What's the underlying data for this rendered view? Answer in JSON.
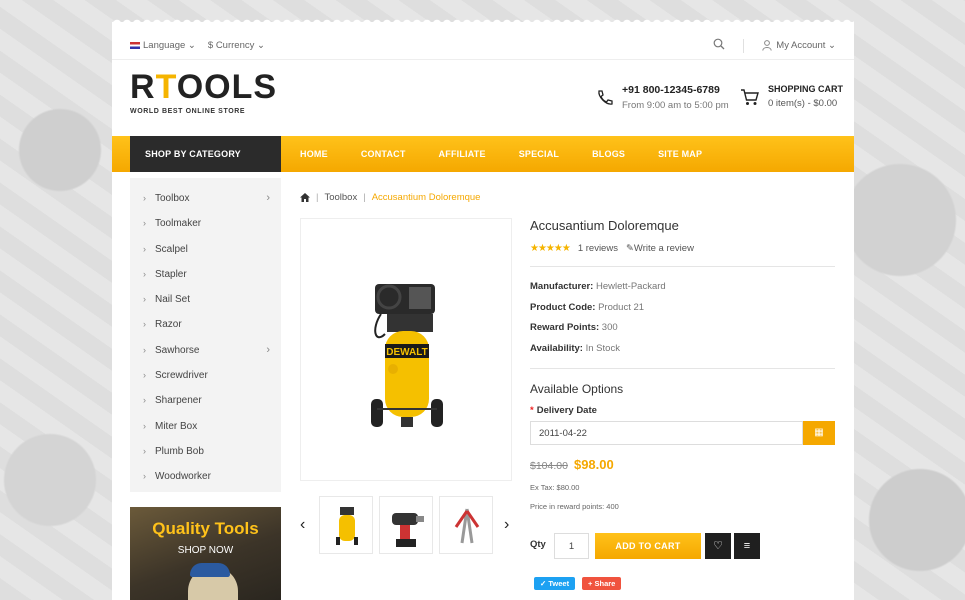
{
  "topbar": {
    "language": "Language",
    "currency": "$ Currency",
    "account": "My Account"
  },
  "logo": {
    "main_a": "R",
    "main_b": "T",
    "main_c": "OOLS",
    "tagline": "WORLD BEST ONLINE STORE"
  },
  "contact": {
    "phone": "+91 800-12345-6789",
    "hours": "From 9:00 am to 5:00 pm"
  },
  "cart": {
    "title": "SHOPPING CART",
    "summary": "0 item(s) - $0.00"
  },
  "nav": {
    "shop_by_category": "SHOP BY CATEGORY",
    "links": [
      "HOME",
      "CONTACT",
      "AFFILIATE",
      "SPECIAL",
      "BLOGS",
      "SITE MAP"
    ]
  },
  "sidebar": {
    "items": [
      {
        "label": "Toolbox",
        "has_sub": true
      },
      {
        "label": "Toolmaker",
        "has_sub": false
      },
      {
        "label": "Scalpel",
        "has_sub": false
      },
      {
        "label": "Stapler",
        "has_sub": false
      },
      {
        "label": "Nail Set",
        "has_sub": false
      },
      {
        "label": "Razor",
        "has_sub": false
      },
      {
        "label": "Sawhorse",
        "has_sub": true
      },
      {
        "label": "Screwdriver",
        "has_sub": false
      },
      {
        "label": "Sharpener",
        "has_sub": false
      },
      {
        "label": "Miter Box",
        "has_sub": false
      },
      {
        "label": "Plumb Bob",
        "has_sub": false
      },
      {
        "label": "Woodworker",
        "has_sub": false
      }
    ]
  },
  "banner": {
    "title": "Quality Tools",
    "cta": "SHOP NOW"
  },
  "breadcrumb": {
    "category": "Toolbox",
    "current": "Accusantium Doloremque"
  },
  "product": {
    "brand_on_image": "DEWALT",
    "title": "Accusantium Doloremque",
    "rating": 5,
    "reviews": "1 reviews",
    "write_review": "Write a review",
    "manufacturer_label": "Manufacturer:",
    "manufacturer": "Hewlett-Packard",
    "code_label": "Product Code:",
    "code": "Product 21",
    "points_label": "Reward Points:",
    "points": "300",
    "availability_label": "Availability:",
    "availability": "In Stock",
    "options_title": "Available Options",
    "delivery_label": "Delivery Date",
    "delivery_value": "2011-04-22",
    "old_price": "$104.00",
    "new_price": "$98.00",
    "ex_tax": "Ex Tax: $80.00",
    "reward_price": "Price in reward points: 400",
    "qty_label": "Qty",
    "qty_value": "1",
    "add_to_cart": "ADD TO CART",
    "tweet": "Tweet",
    "share": "Share"
  },
  "colors": {
    "accent": "#f5a800",
    "dark": "#2b2b2b"
  }
}
